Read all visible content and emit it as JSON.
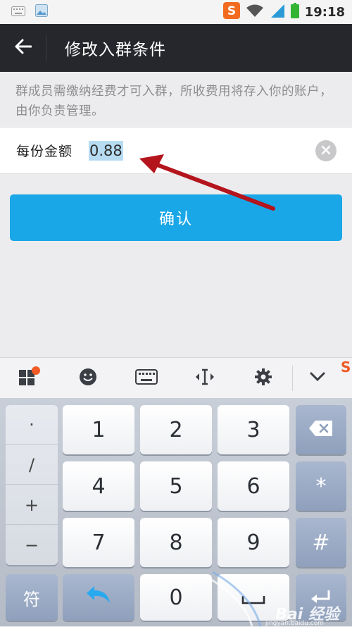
{
  "status_bar": {
    "time": "19:18",
    "icons": [
      "keyboard-icon",
      "image-icon",
      "sogou-icon",
      "wifi-icon",
      "signal-icon",
      "battery-icon"
    ]
  },
  "header": {
    "title": "修改入群条件"
  },
  "notice": {
    "text": "群成员需缴纳经费才可入群，所收费用将存入你的账户，由你负责管理。"
  },
  "amount": {
    "label": "每份金额",
    "value": "0.88"
  },
  "confirm": {
    "label": "确认"
  },
  "keyboard": {
    "symbols": [
      "·",
      "/",
      "+",
      "−"
    ],
    "rows": [
      [
        "1",
        "2",
        "3"
      ],
      [
        "4",
        "5",
        "6"
      ],
      [
        "7",
        "8",
        "9"
      ]
    ],
    "right_keys": [
      "*",
      "#"
    ],
    "symbol_switch": "符",
    "zero": "0"
  },
  "watermark": {
    "brand": "Bai 经验",
    "url": "jingyan.baidu.com"
  },
  "colors": {
    "header_bg": "#25272c",
    "accent": "#19a7e8",
    "arrow": "#b4141c",
    "highlight": "#b7dcf2"
  }
}
